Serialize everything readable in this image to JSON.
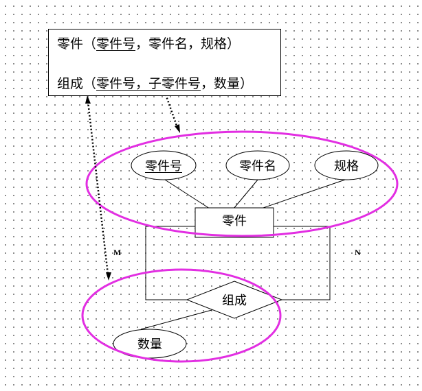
{
  "schema": {
    "relation1": {
      "name": "零件",
      "open": "（",
      "key": "零件号",
      "rest": "，零件名，规格）"
    },
    "relation2": {
      "name": "组成",
      "open": "（",
      "key": "零件号，子零件号",
      "rest": "，数量）"
    }
  },
  "er": {
    "entity": "零件",
    "entity_attributes": [
      {
        "label": "零件号",
        "primary_key": true
      },
      {
        "label": "零件名",
        "primary_key": false
      },
      {
        "label": "规格",
        "primary_key": false
      }
    ],
    "relationship": "组成",
    "relationship_attribute": "数量",
    "cardinality_left": "M",
    "cardinality_right": "N"
  },
  "colors": {
    "highlight": "#e22ee2",
    "line": "#000000",
    "background": "#ffffff"
  }
}
